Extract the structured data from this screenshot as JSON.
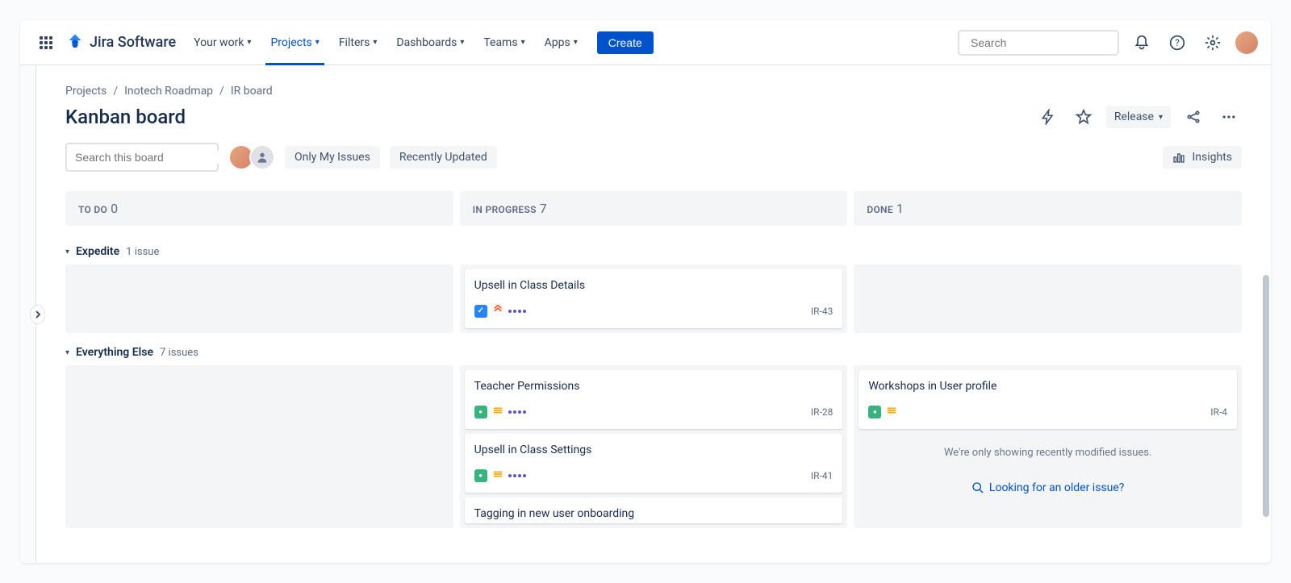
{
  "topnav": {
    "logo_text": "Jira Software",
    "items": [
      {
        "label": "Your work"
      },
      {
        "label": "Projects",
        "active": true
      },
      {
        "label": "Filters"
      },
      {
        "label": "Dashboards"
      },
      {
        "label": "Teams"
      },
      {
        "label": "Apps"
      }
    ],
    "create_label": "Create",
    "search_placeholder": "Search"
  },
  "breadcrumb": {
    "projects": "Projects",
    "project_name": "Inotech Roadmap",
    "board_name": "IR board"
  },
  "board": {
    "title": "Kanban board",
    "release_label": "Release",
    "insights_label": "Insights",
    "search_placeholder": "Search this board",
    "only_my_issues": "Only My Issues",
    "recently_updated": "Recently Updated"
  },
  "columns": [
    {
      "name": "TO DO",
      "count": "0"
    },
    {
      "name": "IN PROGRESS",
      "count": "7"
    },
    {
      "name": "DONE",
      "count": "1"
    }
  ],
  "swimlanes": [
    {
      "name": "Expedite",
      "count_label": "1 issue",
      "cards": {
        "todo": [],
        "inprogress": [
          {
            "title": "Upsell in Class Details",
            "type": "task",
            "priority": "highest",
            "key": "IR-43"
          }
        ],
        "done": []
      }
    },
    {
      "name": "Everything Else",
      "count_label": "7 issues",
      "cards": {
        "todo": [],
        "inprogress": [
          {
            "title": "Teacher Permissions",
            "type": "story",
            "priority": "medium",
            "key": "IR-28"
          },
          {
            "title": "Upsell in Class Settings",
            "type": "story",
            "priority": "medium",
            "key": "IR-41"
          },
          {
            "title": "Tagging in new user onboarding",
            "type": "story",
            "priority": "medium",
            "key": ""
          }
        ],
        "done": [
          {
            "title": "Workshops in User profile",
            "type": "story",
            "priority": "medium",
            "key": "IR-4"
          }
        ]
      }
    }
  ],
  "done_placeholder": {
    "msg": "We're only showing recently modified issues.",
    "link": "Looking for an older issue?"
  }
}
